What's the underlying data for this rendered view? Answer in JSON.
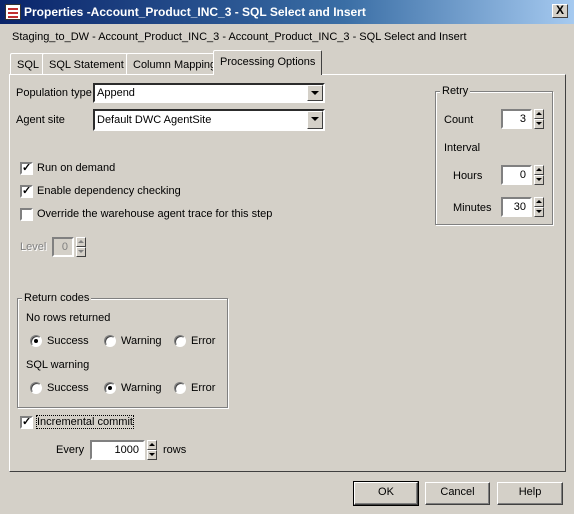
{
  "window": {
    "title": "Properties -Account_Product_INC_3 - SQL Select and Insert",
    "close_label": "X",
    "icon_name": "properties-app-icon"
  },
  "breadcrumb": "Staging_to_DW - Account_Product_INC_3 - Account_Product_INC_3 - SQL Select and Insert",
  "tabs": [
    {
      "label": "SQL"
    },
    {
      "label": "SQL Statement"
    },
    {
      "label": "Column Mapping"
    },
    {
      "label": "Processing Options",
      "active": true
    }
  ],
  "population_type": {
    "label": "Population type",
    "value": "Append"
  },
  "agent_site": {
    "label": "Agent site",
    "value": "Default DWC AgentSite"
  },
  "options": {
    "run_on_demand": {
      "label": "Run on demand",
      "checked": true
    },
    "enable_dependency": {
      "label": "Enable dependency checking",
      "checked": true
    },
    "override_trace": {
      "label": "Override the warehouse agent trace for this step",
      "checked": false
    }
  },
  "level": {
    "label": "Level",
    "value": "0"
  },
  "retry": {
    "title": "Retry",
    "count_label": "Count",
    "count_value": "3",
    "interval_label": "Interval",
    "hours_label": "Hours",
    "hours_value": "0",
    "minutes_label": "Minutes",
    "minutes_value": "30"
  },
  "return_codes": {
    "title": "Return codes",
    "no_rows": {
      "label": "No rows returned",
      "options": [
        "Success",
        "Warning",
        "Error"
      ],
      "selected": "Success"
    },
    "sql_warning": {
      "label": "SQL warning",
      "options": [
        "Success",
        "Warning",
        "Error"
      ],
      "selected": "Warning"
    }
  },
  "incremental_commit": {
    "label": "Incremental commit",
    "checked": true
  },
  "every": {
    "label": "Every",
    "value": "1000",
    "unit": "rows"
  },
  "buttons": {
    "ok": "OK",
    "cancel": "Cancel",
    "help": "Help"
  }
}
